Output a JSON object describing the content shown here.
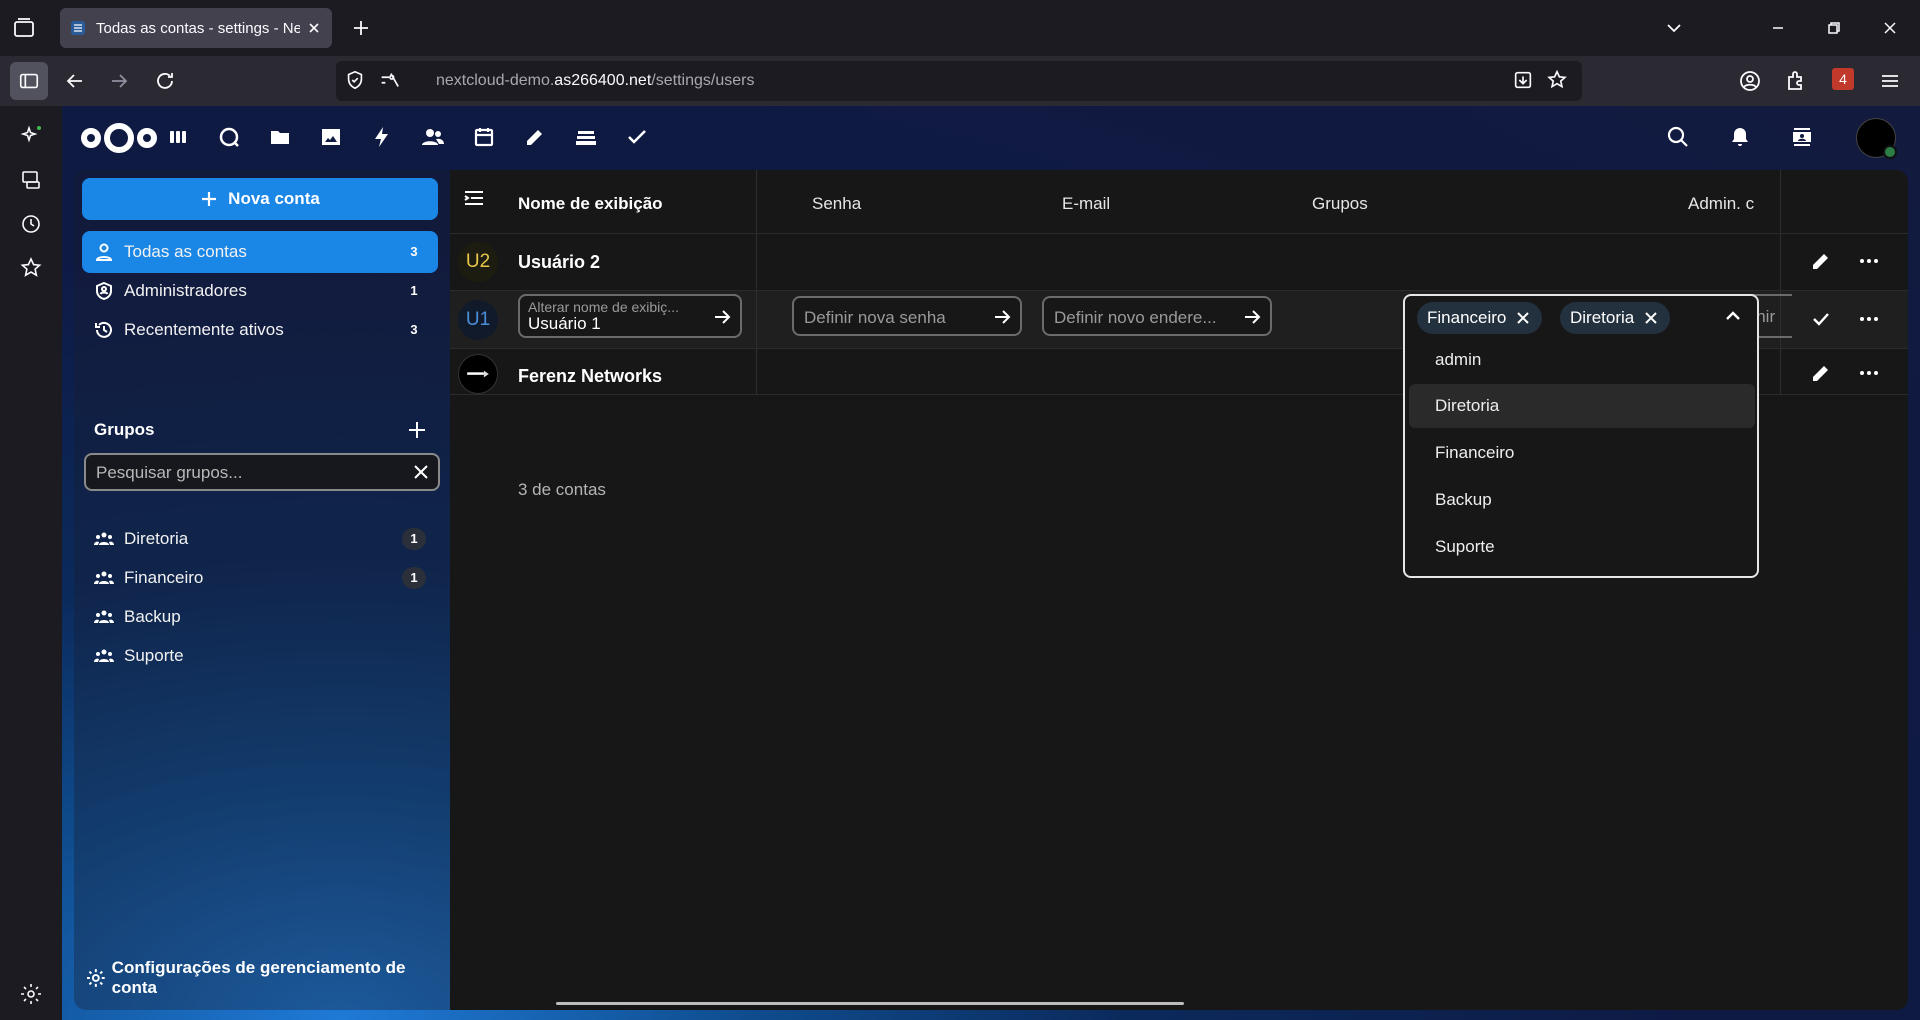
{
  "browser": {
    "tab_title": "Todas as contas - settings - Nextcloud",
    "url_prefix": "nextcloud-demo.",
    "url_domain": "as266400.net",
    "url_path": "/settings/users",
    "extension_badge": "4"
  },
  "header": {
    "apps": [
      "dashboard-icon",
      "search-icon",
      "files-icon",
      "photos-icon",
      "activity-icon",
      "contacts-icon",
      "calendar-icon",
      "notes-icon",
      "deck-icon",
      "tasks-icon"
    ]
  },
  "sidebar": {
    "new_account": "Nova conta",
    "items": [
      {
        "label": "Todas as contas",
        "count": "3"
      },
      {
        "label": "Administradores",
        "count": "1"
      },
      {
        "label": "Recentemente ativos",
        "count": "3"
      }
    ],
    "groups_title": "Grupos",
    "group_search_placeholder": "Pesquisar grupos...",
    "groups": [
      {
        "label": "Diretoria",
        "count": "1"
      },
      {
        "label": "Financeiro",
        "count": "1"
      },
      {
        "label": "Backup",
        "count": ""
      },
      {
        "label": "Suporte",
        "count": ""
      }
    ],
    "settings": "Configurações de gerenciamento de conta"
  },
  "table": {
    "columns": {
      "display_name": "Nome de exibição",
      "password": "Senha",
      "email": "E-mail",
      "groups": "Grupos",
      "admin": "Admin. c"
    },
    "rows": [
      {
        "initials": "U2",
        "name": "Usuário 2"
      },
      {
        "initials": "U1",
        "name_label": "Alterar nome de exibiç...",
        "name_value": "Usuário 1",
        "password_placeholder": "Definir nova senha",
        "email_placeholder": "Definir novo endere...",
        "admin_placeholder": "Definir"
      },
      {
        "name": "Ferenz Networks"
      }
    ],
    "selected_groups": [
      "Financeiro",
      "Diretoria"
    ],
    "group_options": [
      "admin",
      "Diretoria",
      "Financeiro",
      "Backup",
      "Suporte"
    ],
    "footer_count": "3 de contas"
  }
}
